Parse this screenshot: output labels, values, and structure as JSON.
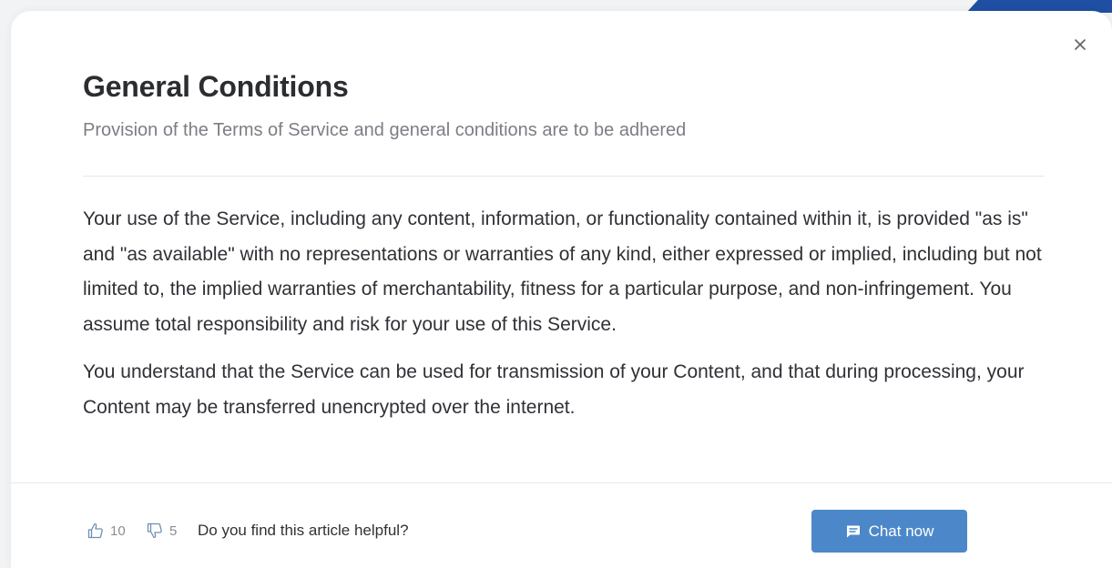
{
  "modal": {
    "title": "General Conditions",
    "subtitle": "Provision of the Terms of Service and general conditions are to be adhered",
    "close_icon": "close-icon",
    "paragraphs": [
      "Your use of the Service, including any content, information, or functionality contained within it, is provided \"as is\" and \"as available\" with no representations or warranties of any kind, either expressed or implied, including but not limited to, the implied warranties of merchantability, fitness for a particular purpose, and non-infringement. You assume total responsibility and risk for your use of this Service.",
      "You understand that the Service can be used for transmission of your Content, and that during processing, your Content may be transferred unencrypted over the internet."
    ]
  },
  "footer": {
    "upvote_count": "10",
    "downvote_count": "5",
    "helpful_prompt": "Do you find this article helpful?",
    "chat_label": "Chat now",
    "icons": {
      "upvote": "thumbs-up-icon",
      "downvote": "thumbs-down-icon",
      "chat": "chat-bubble-icon"
    }
  },
  "colors": {
    "accent": "#4c88c9",
    "title": "#2b2d31",
    "subtitle": "#7b7e84",
    "corner_brand": "#1f4fa3"
  }
}
